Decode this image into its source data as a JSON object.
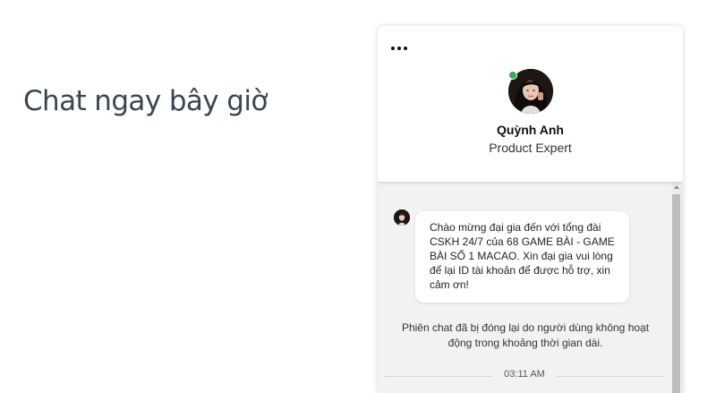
{
  "page": {
    "heading": "Chat ngay bây giờ"
  },
  "widget": {
    "menu_icon": "more-horizontal-icon",
    "agent": {
      "name": "Quỳnh Anh",
      "role": "Product Expert",
      "status": "online",
      "status_color": "#3aa859"
    },
    "messages": [
      {
        "sender": "agent",
        "text": "Chào mừng đại gia đến với tổng đài CSKH 24/7 của 68 GAME BÀI - GAME BÀI SỐ 1 MACAO. Xin đại gia vui lòng để lại ID tài khoản để được hỗ trợ, xin cảm ơn!"
      }
    ],
    "system_note": "Phiên chat đã bị đóng lại do người dùng không hoạt động trong khoảng thời gian dài.",
    "timestamp": "03:11 AM"
  },
  "colors": {
    "heading": "#3a4651",
    "chat_background": "#f2f2f2",
    "bubble": "#ffffff"
  }
}
